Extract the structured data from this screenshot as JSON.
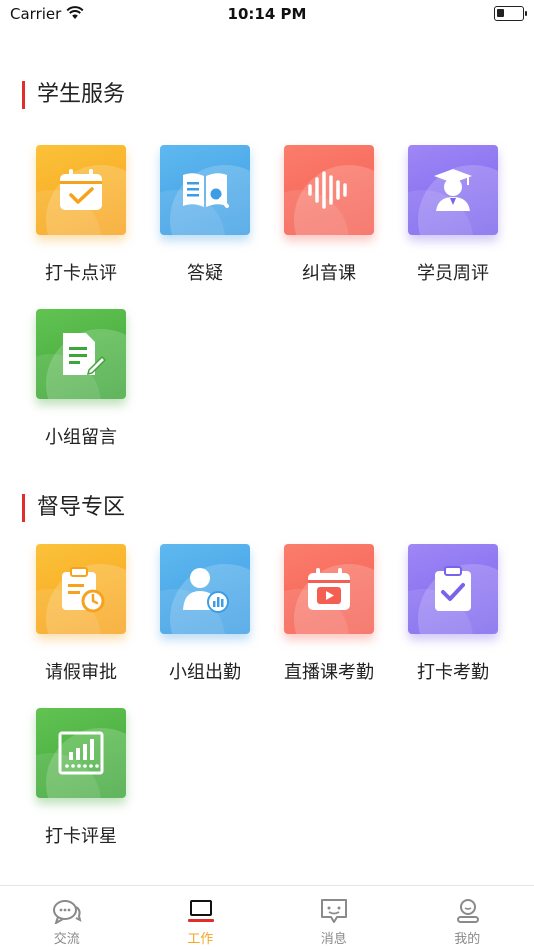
{
  "status_bar": {
    "carrier": "Carrier",
    "time": "10:14 PM",
    "battery_level": 0.3
  },
  "sections": [
    {
      "title": "学生服务",
      "items": [
        {
          "label": "打卡点评",
          "icon": "calendar-check-icon",
          "color": "#f7a21c"
        },
        {
          "label": "答疑",
          "icon": "book-search-icon",
          "color": "#3d9de4"
        },
        {
          "label": "纠音课",
          "icon": "soundwave-icon",
          "color": "#f45f52"
        },
        {
          "label": "学员周评",
          "icon": "graduate-icon",
          "color": "#7a63ec"
        },
        {
          "label": "小组留言",
          "icon": "document-edit-icon",
          "color": "#3ea53a"
        }
      ]
    },
    {
      "title": "督导专区",
      "items": [
        {
          "label": "请假审批",
          "icon": "clipboard-clock-icon",
          "color": "#f7a21c"
        },
        {
          "label": "小组出勤",
          "icon": "user-chart-icon",
          "color": "#3d9de4"
        },
        {
          "label": "直播课考勤",
          "icon": "calendar-play-icon",
          "color": "#f45f52"
        },
        {
          "label": "打卡考勤",
          "icon": "clipboard-check-icon",
          "color": "#7a63ec"
        },
        {
          "label": "打卡评星",
          "icon": "chart-stars-icon",
          "color": "#3ea53a"
        }
      ]
    }
  ],
  "tabs": [
    {
      "label": "交流",
      "icon": "chat-icon",
      "active": false
    },
    {
      "label": "工作",
      "icon": "laptop-icon",
      "active": true
    },
    {
      "label": "消息",
      "icon": "message-icon",
      "active": false
    },
    {
      "label": "我的",
      "icon": "profile-icon",
      "active": false
    }
  ],
  "colors": {
    "accent": "#e32d2d",
    "tab_active": "#f5a623",
    "tab_inactive": "#8a8a8a"
  }
}
